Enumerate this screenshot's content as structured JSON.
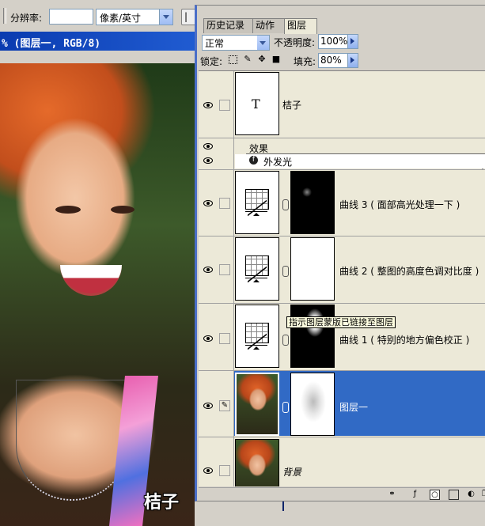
{
  "options_bar": {
    "resolution_label": "分辨率:",
    "resolution_value": "",
    "unit_value": "像素/英寸",
    "clip_button_text": "|"
  },
  "document": {
    "title_text": "% (图层一, RGB/8)",
    "photo_caption": "桔子"
  },
  "panel": {
    "tabs": [
      {
        "label": "历史记录",
        "active": false
      },
      {
        "label": "动作",
        "active": false
      },
      {
        "label": "图层",
        "active": true
      }
    ],
    "blend_mode": "正常",
    "opacity_label": "不透明度:",
    "opacity_value": "100%",
    "lock_label": "锁定:",
    "lock_icons": [
      "transparency-lock-icon",
      "brush-lock-icon",
      "move-lock-icon",
      "padlock-icon"
    ],
    "fill_label": "填充:",
    "fill_value": "80%"
  },
  "layers": [
    {
      "name": "桔子",
      "type": "text",
      "thumb_glyph": "T",
      "effects_label": "效果",
      "effect_name": "外发光",
      "visible": true
    },
    {
      "name": "曲线 3 ( 面部高光处理一下 )",
      "type": "curves",
      "visible": true
    },
    {
      "name": "曲线 2 ( 整图的高度色调对比度 )",
      "type": "curves",
      "visible": true
    },
    {
      "name": "曲线 1 ( 特别的地方偏色校正 )",
      "type": "curves",
      "visible": true
    },
    {
      "name": "图层一",
      "type": "pixel",
      "selected": true,
      "visible": true
    },
    {
      "name": "背景",
      "type": "background",
      "visible": true
    }
  ],
  "tooltip": "指示图层蒙版已链接至图层",
  "colors": {
    "selection": "#316ac5",
    "title_bar": "#0a3bb0",
    "panel_bg": "#ece9d8"
  },
  "footer_icons": [
    "link-layers-icon",
    "layer-style-icon",
    "add-mask-icon",
    "new-group-icon",
    "adjustment-layer-icon",
    "new-layer-icon",
    "trash-icon"
  ]
}
